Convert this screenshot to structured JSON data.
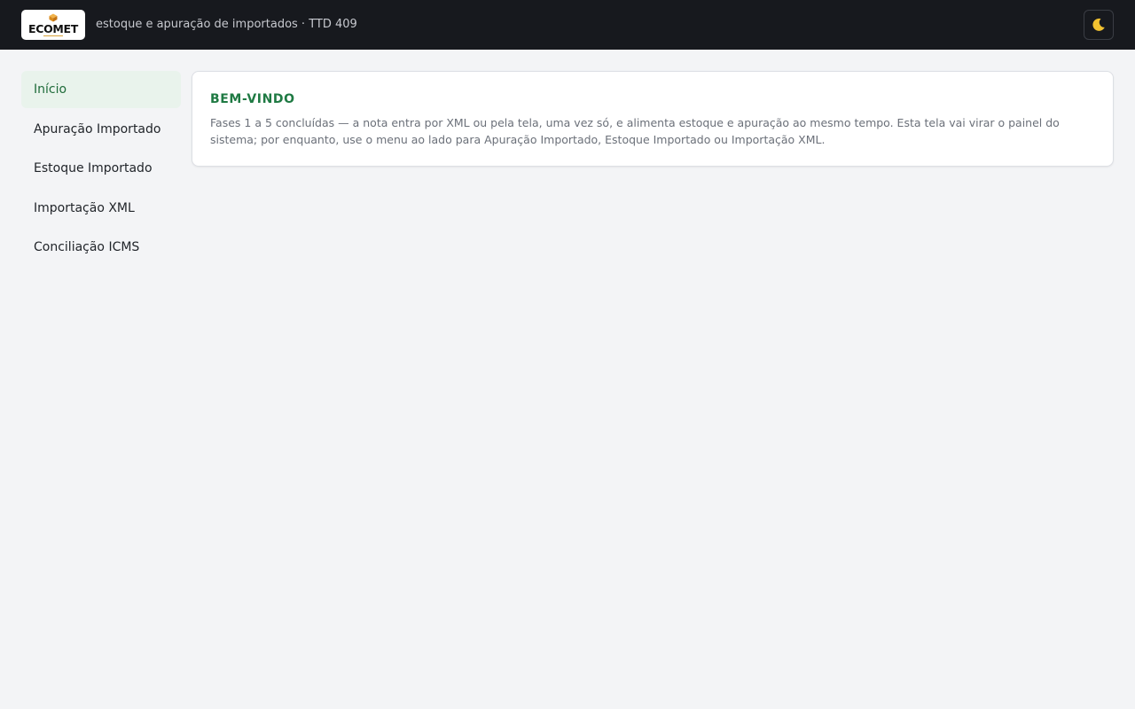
{
  "header": {
    "logo_text": "ECOMET",
    "subtitle": "estoque e apuração de importados · TTD 409",
    "theme_icon": "moon-icon"
  },
  "sidebar": {
    "items": [
      {
        "label": "Início",
        "active": true
      },
      {
        "label": "Apuração Importado",
        "active": false
      },
      {
        "label": "Estoque Importado",
        "active": false
      },
      {
        "label": "Importação XML",
        "active": false
      },
      {
        "label": "Conciliação ICMS",
        "active": false
      }
    ]
  },
  "welcome": {
    "title": "BEM-VINDO",
    "text": "Fases 1 a 5 concluídas — a nota entra por XML ou pela tela, uma vez só, e alimenta estoque e apuração ao mesmo tempo. Esta tela vai virar o painel do sistema; por enquanto, use o menu ao lado para Apuração Importado, Estoque Importado ou Importação XML."
  },
  "colors": {
    "topbar": "#17191e",
    "accent": "#1f7a43",
    "active_bg": "#e9f3ec",
    "page_bg": "#f3f4f6"
  }
}
